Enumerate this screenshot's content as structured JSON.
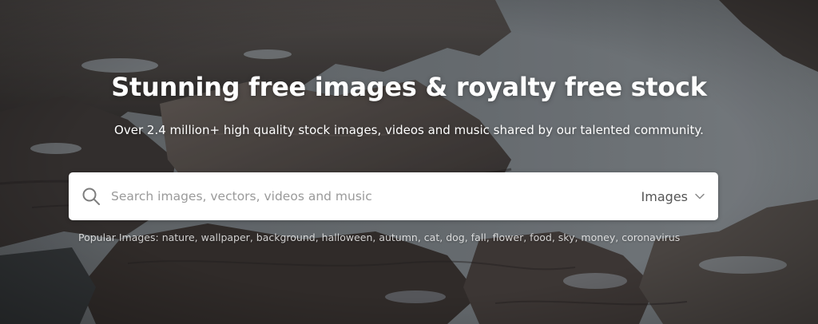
{
  "hero": {
    "headline": "Stunning free images & royalty free stock",
    "subline": "Over 2.4 million+ high quality stock images, videos and music shared by our talented community."
  },
  "search": {
    "placeholder": "Search images, vectors, videos and music",
    "value": "",
    "type_selected": "Images",
    "search_icon": "search-icon",
    "dropdown_icon": "chevron-down-icon"
  },
  "popular": {
    "label": "Popular Images:",
    "tags": [
      "nature",
      "wallpaper",
      "background",
      "halloween",
      "autumn",
      "cat",
      "dog",
      "fall",
      "flower",
      "food",
      "sky",
      "money",
      "coronavirus"
    ]
  },
  "colors": {
    "headline_text": "#ffffff",
    "search_background": "#ffffff",
    "placeholder_text": "#9a9a9a"
  }
}
